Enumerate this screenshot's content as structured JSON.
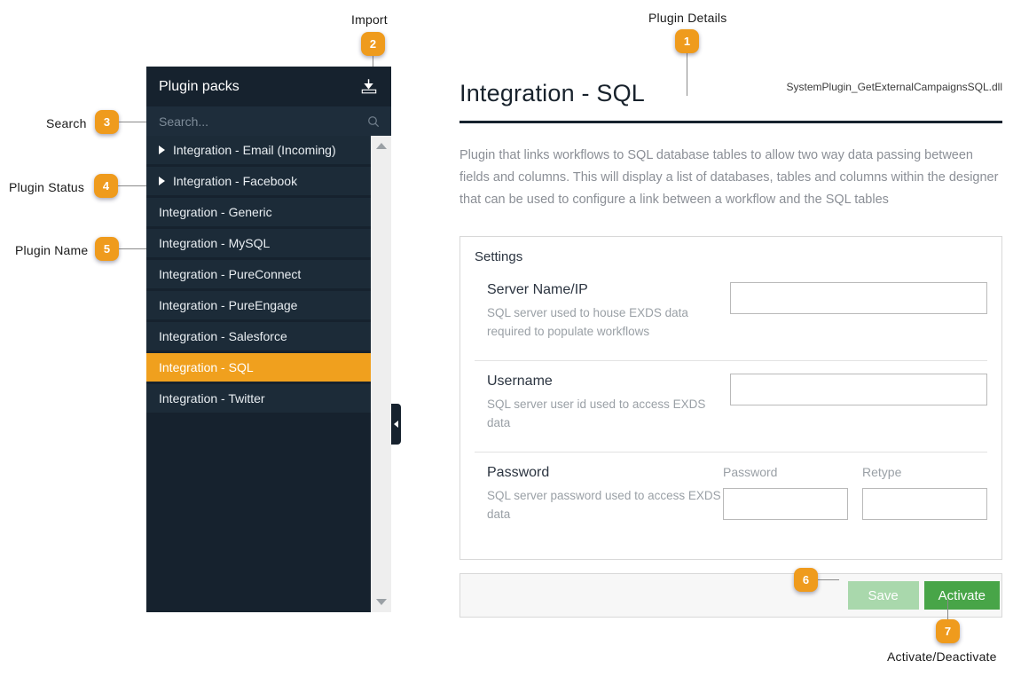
{
  "annotations": [
    {
      "id": "1",
      "label": "Plugin Details",
      "number": "1"
    },
    {
      "id": "2",
      "label": "Import",
      "number": "2"
    },
    {
      "id": "3",
      "label": "Search",
      "number": "3"
    },
    {
      "id": "4",
      "label": "Plugin Status",
      "number": "4"
    },
    {
      "id": "5",
      "label": "Plugin Name",
      "number": "5"
    },
    {
      "id": "6",
      "label": "Save",
      "number": "6"
    },
    {
      "id": "7",
      "label": "Activate/Deactivate",
      "number": "7"
    }
  ],
  "sidebar": {
    "title": "Plugin packs",
    "import_icon": "import-icon",
    "search": {
      "placeholder": "Search...",
      "value": "",
      "icon": "search-icon"
    },
    "scrollbar": {
      "up_icon": "chevron-up-icon",
      "down_icon": "chevron-down-icon"
    },
    "collapse_icon": "chevron-left-icon",
    "items": [
      {
        "label": "Integration - Email (Incoming)",
        "expandable": true,
        "selected": false
      },
      {
        "label": "Integration - Facebook",
        "expandable": true,
        "selected": false
      },
      {
        "label": "Integration - Generic",
        "expandable": false,
        "selected": false
      },
      {
        "label": "Integration - MySQL",
        "expandable": false,
        "selected": false
      },
      {
        "label": "Integration - PureConnect",
        "expandable": false,
        "selected": false
      },
      {
        "label": "Integration - PureEngage",
        "expandable": false,
        "selected": false
      },
      {
        "label": "Integration - Salesforce",
        "expandable": false,
        "selected": false
      },
      {
        "label": "Integration - SQL",
        "expandable": false,
        "selected": true
      },
      {
        "label": "Integration - Twitter",
        "expandable": false,
        "selected": false
      }
    ]
  },
  "detail": {
    "title": "Integration - SQL",
    "filename": "SystemPlugin_GetExternalCampaignsSQL.dll",
    "description": "Plugin that links workflows to SQL database tables to allow two way data passing between fields and columns. This will display a list of databases, tables and columns within the designer that can be used to configure a link between a workflow and the SQL tables",
    "settings_heading": "Settings",
    "settings": [
      {
        "label": "Server Name/IP",
        "help": "SQL server used to house EXDS data required to populate workflows",
        "fields": [
          {
            "caption": "",
            "value": "",
            "placeholder": ""
          }
        ]
      },
      {
        "label": "Username",
        "help": "SQL server user id used to access EXDS data",
        "fields": [
          {
            "caption": "",
            "value": "",
            "placeholder": ""
          }
        ]
      },
      {
        "label": "Password",
        "help": "SQL server password used to access EXDS data",
        "fields": [
          {
            "caption": "Password",
            "value": "",
            "placeholder": ""
          },
          {
            "caption": "Retype",
            "value": "",
            "placeholder": ""
          }
        ]
      }
    ],
    "actions": {
      "save_label": "Save",
      "activate_label": "Activate"
    }
  },
  "colors": {
    "panel_dark": "#16222e",
    "row_dark": "#1c2b38",
    "accent_orange": "#f0a01e",
    "badge_orange": "#ef9b1d",
    "save_green": "#a9d8ac",
    "activate_green": "#48a548"
  }
}
